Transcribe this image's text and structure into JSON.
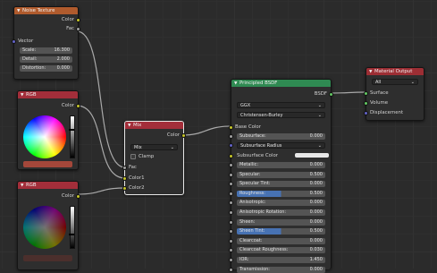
{
  "nodes": {
    "noise": {
      "title": "Noise Texture",
      "outputs": [
        "Color",
        "Fac"
      ],
      "vector_label": "Vector",
      "fields": [
        {
          "label": "Scale:",
          "value": "16.300"
        },
        {
          "label": "Detail:",
          "value": "2.000"
        },
        {
          "label": "Distortion:",
          "value": "0.000"
        }
      ]
    },
    "rgb1": {
      "title": "RGB",
      "output": "Color",
      "swatch_color": "#a4473a"
    },
    "rgb2": {
      "title": "RGB",
      "output": "Color",
      "swatch_color": "#4b2f2c"
    },
    "mix": {
      "title": "Mix",
      "output": "Color",
      "mode": "Mix",
      "clamp_label": "Clamp",
      "inputs": [
        "Fac",
        "Color1",
        "Color2"
      ]
    },
    "bsdf": {
      "title": "Principled BSDF",
      "output": "BSDF",
      "distribution": "GGX",
      "subsurface_method": "Christensen-Burley",
      "base_color_label": "Base Color",
      "subsurface": {
        "label": "Subsurface:",
        "value": "0.000"
      },
      "subsurface_radius": "Subsurface Radius",
      "subsurface_color": "Subsurface Color",
      "fields": [
        {
          "label": "Metallic:",
          "value": "0.000",
          "fill": 0
        },
        {
          "label": "Specular:",
          "value": "0.500",
          "fill": 0
        },
        {
          "label": "Specular Tint:",
          "value": "0.000",
          "fill": 0
        },
        {
          "label": "Roughness:",
          "value": "0.500",
          "fill": 50
        },
        {
          "label": "Anisotropic:",
          "value": "0.000",
          "fill": 0
        },
        {
          "label": "Anisotropic Rotation:",
          "value": "0.000",
          "fill": 0
        },
        {
          "label": "Sheen:",
          "value": "0.000",
          "fill": 0
        },
        {
          "label": "Sheen Tint:",
          "value": "0.500",
          "fill": 50
        },
        {
          "label": "Clearcoat:",
          "value": "0.000",
          "fill": 0
        },
        {
          "label": "Clearcoat Roughness:",
          "value": "0.030",
          "fill": 3
        },
        {
          "label": "IOR:",
          "value": "1.450",
          "fill": 0
        },
        {
          "label": "Transmission:",
          "value": "0.000",
          "fill": 0
        }
      ]
    },
    "output": {
      "title": "Material Output",
      "target": "All",
      "inputs": [
        "Surface",
        "Volume",
        "Displacement"
      ]
    }
  },
  "colors": {
    "texture_header": "#b05b2d",
    "color_header": "#a32e3a",
    "shader_header": "#2f8a52",
    "output_header": "#9c2e34",
    "link": "#a9a9a9"
  }
}
